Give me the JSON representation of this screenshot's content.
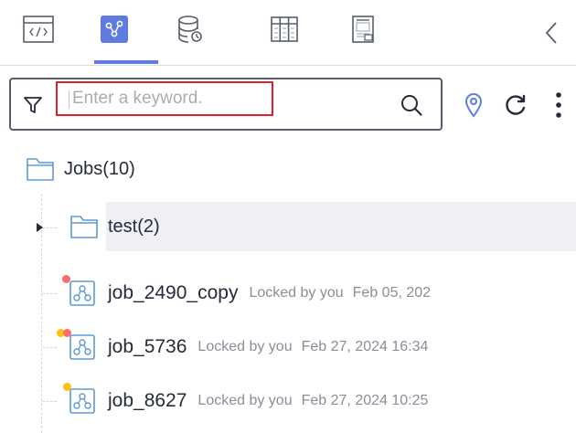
{
  "colors": {
    "accent": "#5e7ce0",
    "highlight_border": "#e0202e",
    "dot_red": "#f66f6a",
    "dot_yellow": "#fac20a",
    "selected_row_bg": "#eef0f5"
  },
  "tabs": [
    {
      "icon": "code-tag-icon",
      "active": false
    },
    {
      "icon": "job-network-icon",
      "active": true
    },
    {
      "icon": "database-icon",
      "active": false
    },
    {
      "icon": "table-grid-icon",
      "active": false
    },
    {
      "icon": "document-icon",
      "active": false
    }
  ],
  "search": {
    "placeholder": "Enter a keyword.",
    "value": ""
  },
  "toolbar_icons": [
    "filter-icon",
    "search-icon",
    "location-pin-icon",
    "refresh-icon",
    "more-vertical-icon",
    "chevron-left-icon"
  ],
  "tree": {
    "root": {
      "label": "Jobs",
      "count": "(10)"
    },
    "folder": {
      "label": "test",
      "count": "(2)",
      "expanded": false,
      "selected": true
    },
    "jobs": [
      {
        "name": "job_2490_copy",
        "lock": "Locked by you",
        "time": "Feb 05, 202",
        "dots": [
          "red"
        ]
      },
      {
        "name": "job_5736",
        "lock": "Locked by you",
        "time": "Feb 27, 2024 16:34",
        "dots": [
          "yellow",
          "red"
        ]
      },
      {
        "name": "job_8627",
        "lock": "Locked by you",
        "time": "Feb 27, 2024 10:25",
        "dots": [
          "yellow"
        ]
      }
    ]
  }
}
